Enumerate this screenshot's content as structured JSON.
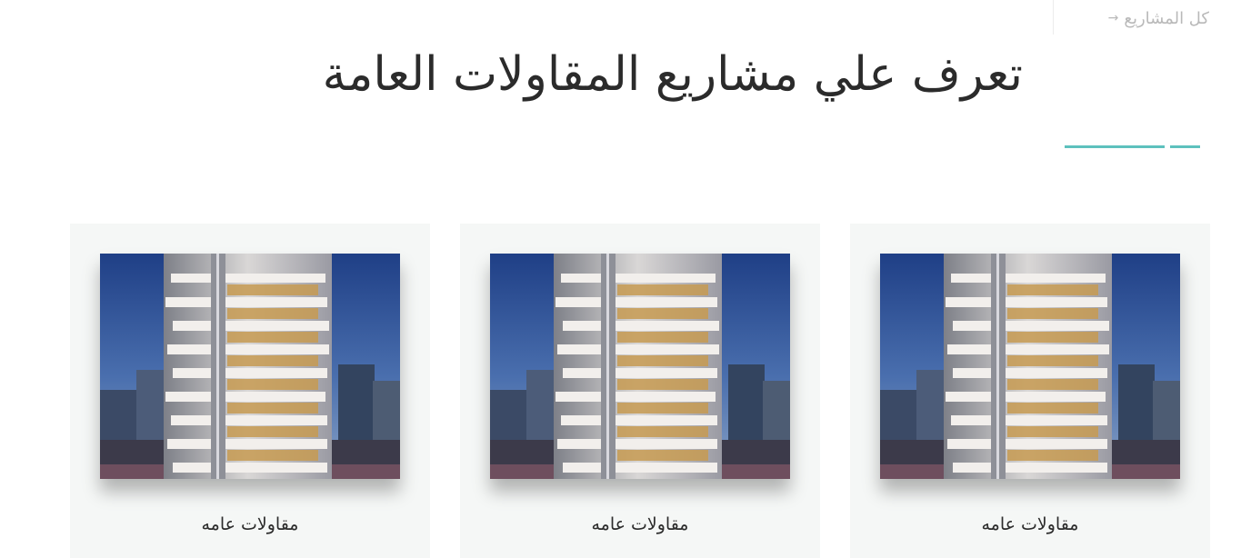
{
  "header": {
    "all_projects_label": "كل المشاريع",
    "title": "تعرف علي مشاريع المقاولات العامة"
  },
  "accent_color": "#5dc1bd",
  "projects": [
    {
      "label": "مقاولات عامه"
    },
    {
      "label": "مقاولات عامه"
    },
    {
      "label": "مقاولات عامه"
    }
  ]
}
